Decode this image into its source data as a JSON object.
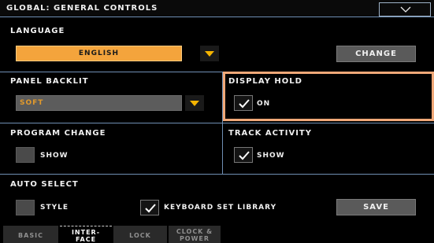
{
  "title": "GLOBAL: GENERAL CONTROLS",
  "menu_icon": "chevron-down-icon",
  "language": {
    "label": "LANGUAGE",
    "value": "ENGLISH",
    "change_button": "CHANGE"
  },
  "panel_backlit": {
    "label": "PANEL BACKLIT",
    "value": "SOFT"
  },
  "display_hold": {
    "label": "DISPLAY HOLD",
    "option_label": "ON",
    "checked": true
  },
  "program_change": {
    "label": "PROGRAM CHANGE",
    "option_label": "SHOW",
    "checked": false
  },
  "track_activity": {
    "label": "TRACK ACTIVITY",
    "option_label": "SHOW",
    "checked": true
  },
  "auto_select": {
    "label": "AUTO SELECT",
    "style_label": "STYLE",
    "style_checked": false,
    "keyboard_set_label": "KEYBOARD SET LIBRARY",
    "keyboard_set_checked": true,
    "save_button": "SAVE"
  },
  "tabs": [
    {
      "line1": "BASIC",
      "line2": "",
      "active": false
    },
    {
      "line1": "INTER-",
      "line2": "FACE",
      "active": true
    },
    {
      "line1": "LOCK",
      "line2": "",
      "active": false
    },
    {
      "line1": "CLOCK &",
      "line2": "POWER",
      "active": false
    }
  ],
  "colors": {
    "accent_orange": "#f4a43c",
    "highlight_frame": "#f0a878",
    "divider_blue": "#6f8fb3",
    "arrow_yellow": "#f5b400"
  }
}
